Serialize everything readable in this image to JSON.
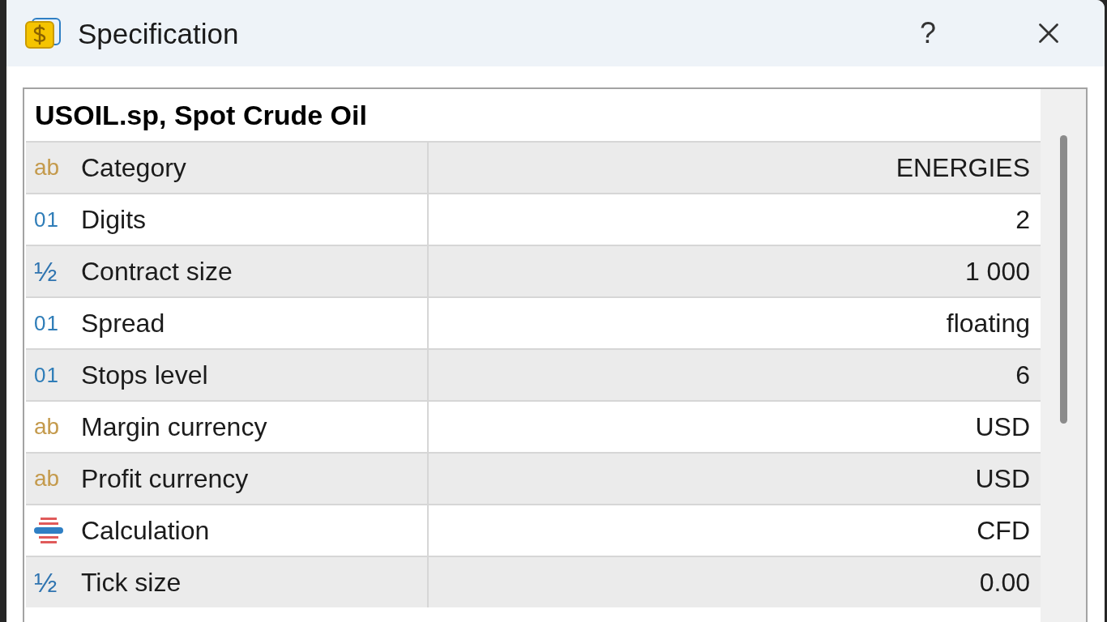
{
  "window": {
    "title": "Specification",
    "help_button": "?"
  },
  "symbol": {
    "title": "USOIL.sp, Spot Crude Oil"
  },
  "rows": [
    {
      "kind": "string",
      "icon": "ab",
      "label": "Category",
      "value": "ENERGIES"
    },
    {
      "kind": "integer",
      "icon": "01",
      "label": "Digits",
      "value": "2"
    },
    {
      "kind": "fraction",
      "icon": "½",
      "label": "Contract size",
      "value": "1 000"
    },
    {
      "kind": "integer",
      "icon": "01",
      "label": "Spread",
      "value": "floating"
    },
    {
      "kind": "integer",
      "icon": "01",
      "label": "Stops level",
      "value": "6"
    },
    {
      "kind": "string",
      "icon": "ab",
      "label": "Margin currency",
      "value": "USD"
    },
    {
      "kind": "string",
      "icon": "ab",
      "label": "Profit currency",
      "value": "USD"
    },
    {
      "kind": "enum",
      "label": "Calculation",
      "value": "CFD"
    },
    {
      "kind": "fraction",
      "icon": "½",
      "label": "Tick size",
      "value": "0.00"
    }
  ]
}
